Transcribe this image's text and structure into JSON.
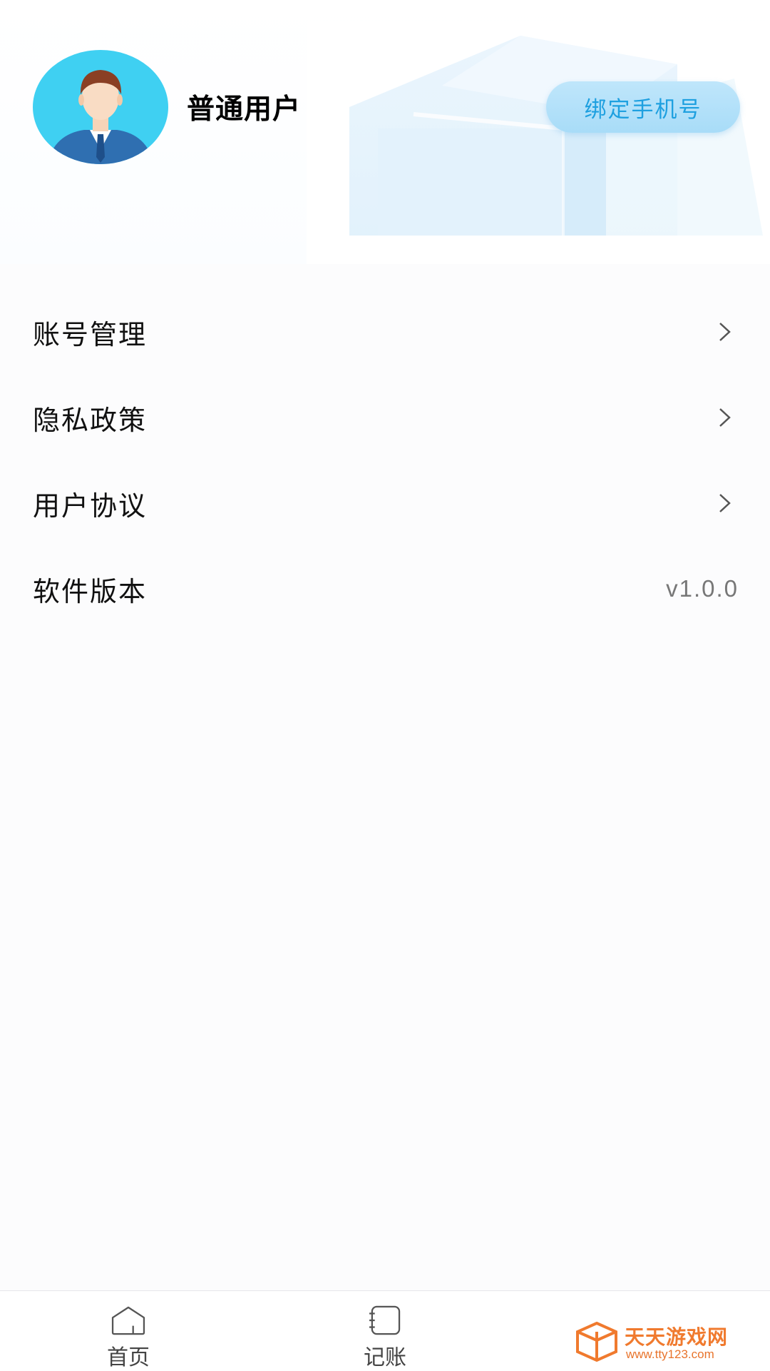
{
  "profile": {
    "username": "普通用户",
    "bind_phone_label": "绑定手机号"
  },
  "menu": {
    "items": [
      {
        "label": "账号管理"
      },
      {
        "label": "隐私政策"
      },
      {
        "label": "用户协议"
      },
      {
        "label": "软件版本",
        "value": "v1.0.0"
      }
    ]
  },
  "tabbar": {
    "tabs": [
      {
        "label": "首页",
        "icon": "home-icon"
      },
      {
        "label": "记账",
        "icon": "notebook-icon"
      }
    ]
  },
  "watermark": {
    "title": "天天游戏网",
    "url": "www.tty123.com"
  },
  "colors": {
    "accent": "#1ea0e0",
    "button_bg": "#b4e1f9",
    "watermark": "#f07a2e"
  }
}
